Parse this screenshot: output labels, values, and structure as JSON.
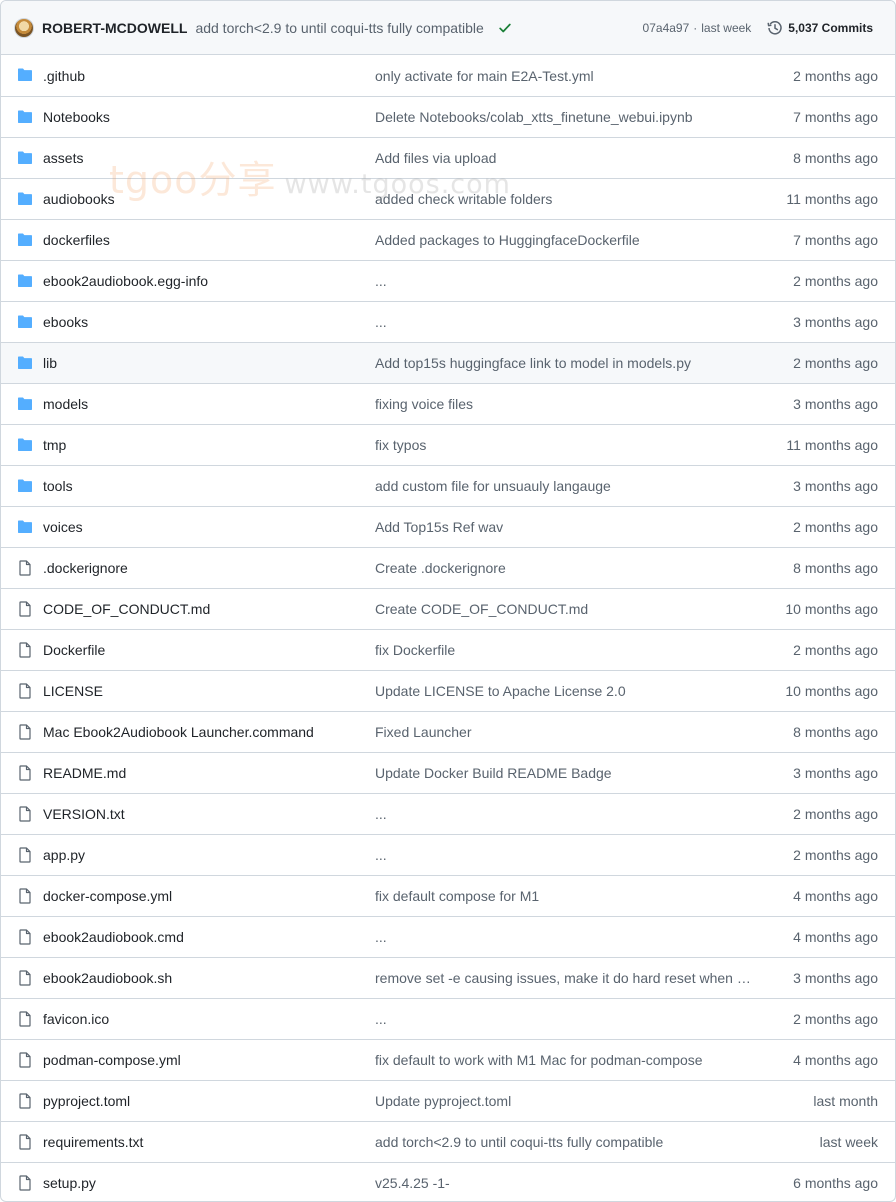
{
  "header": {
    "author": "ROBERT-MCDOWELL",
    "commit_message": "add torch<2.9 to until coqui-tts fully compatible",
    "status_icon": "check-icon",
    "hash": "07a4a97",
    "separator": "·",
    "time": "last week",
    "commits_label": "5,037 Commits"
  },
  "watermark": {
    "brand": "tgoo分享",
    "url": "www.tgoos.com"
  },
  "colors": {
    "folder": "#54aeff",
    "file": "#59636e",
    "check": "#1a7f37",
    "muted": "#59636e",
    "border": "#d0d7de"
  },
  "rows": [
    {
      "type": "folder",
      "icon": "folder-icon",
      "name": ".github",
      "message": "only activate for main E2A-Test.yml",
      "time": "2 months ago"
    },
    {
      "type": "folder",
      "icon": "folder-icon",
      "name": "Notebooks",
      "message": "Delete Notebooks/colab_xtts_finetune_webui.ipynb",
      "time": "7 months ago"
    },
    {
      "type": "folder",
      "icon": "folder-icon",
      "name": "assets",
      "message": "Add files via upload",
      "time": "8 months ago"
    },
    {
      "type": "folder",
      "icon": "folder-icon",
      "name": "audiobooks",
      "message": "added check writable folders",
      "time": "11 months ago"
    },
    {
      "type": "folder",
      "icon": "folder-icon",
      "name": "dockerfiles",
      "message": "Added packages to HuggingfaceDockerfile",
      "time": "7 months ago"
    },
    {
      "type": "folder",
      "icon": "folder-icon",
      "name": "ebook2audiobook.egg-info",
      "message": "...",
      "time": "2 months ago"
    },
    {
      "type": "folder",
      "icon": "folder-icon",
      "name": "ebooks",
      "message": "...",
      "time": "3 months ago"
    },
    {
      "type": "folder",
      "icon": "folder-icon",
      "name": "lib",
      "message": "Add top15s huggingface link to model in models.py",
      "time": "2 months ago",
      "highlighted": true
    },
    {
      "type": "folder",
      "icon": "folder-icon",
      "name": "models",
      "message": "fixing voice files",
      "time": "3 months ago"
    },
    {
      "type": "folder",
      "icon": "folder-icon",
      "name": "tmp",
      "message": "fix typos",
      "time": "11 months ago"
    },
    {
      "type": "folder",
      "icon": "folder-icon",
      "name": "tools",
      "message": "add custom file for unsuauly langauge",
      "time": "3 months ago"
    },
    {
      "type": "folder",
      "icon": "folder-icon",
      "name": "voices",
      "message": "Add Top15s Ref wav",
      "time": "2 months ago"
    },
    {
      "type": "file",
      "icon": "file-icon",
      "name": ".dockerignore",
      "message": "Create .dockerignore",
      "time": "8 months ago"
    },
    {
      "type": "file",
      "icon": "file-icon",
      "name": "CODE_OF_CONDUCT.md",
      "message": "Create CODE_OF_CONDUCT.md",
      "time": "10 months ago"
    },
    {
      "type": "file",
      "icon": "file-icon",
      "name": "Dockerfile",
      "message": "fix Dockerfile",
      "time": "2 months ago"
    },
    {
      "type": "file",
      "icon": "file-icon",
      "name": "LICENSE",
      "message": "Update LICENSE to Apache License 2.0",
      "time": "10 months ago"
    },
    {
      "type": "file",
      "icon": "file-icon",
      "name": "Mac Ebook2Audiobook Launcher.command",
      "message": "Fixed Launcher",
      "time": "8 months ago"
    },
    {
      "type": "file",
      "icon": "file-icon",
      "name": "README.md",
      "message": "Update Docker Build README Badge",
      "time": "3 months ago"
    },
    {
      "type": "file",
      "icon": "file-icon",
      "name": "VERSION.txt",
      "message": "...",
      "time": "2 months ago"
    },
    {
      "type": "file",
      "icon": "file-icon",
      "name": "app.py",
      "message": "...",
      "time": "2 months ago"
    },
    {
      "type": "file",
      "icon": "file-icon",
      "name": "docker-compose.yml",
      "message": "fix default compose for M1",
      "time": "4 months ago"
    },
    {
      "type": "file",
      "icon": "file-icon",
      "name": "ebook2audiobook.cmd",
      "message": "...",
      "time": "4 months ago"
    },
    {
      "type": "file",
      "icon": "file-icon",
      "name": "ebook2audiobook.sh",
      "message": "remove set -e causing issues, make it do hard reset when ch...",
      "time": "3 months ago"
    },
    {
      "type": "file",
      "icon": "file-icon",
      "name": "favicon.ico",
      "message": "...",
      "time": "2 months ago"
    },
    {
      "type": "file",
      "icon": "file-icon",
      "name": "podman-compose.yml",
      "message": "fix default to work with M1 Mac for podman-compose",
      "time": "4 months ago"
    },
    {
      "type": "file",
      "icon": "file-icon",
      "name": "pyproject.toml",
      "message": "Update pyproject.toml",
      "time": "last month"
    },
    {
      "type": "file",
      "icon": "file-icon",
      "name": "requirements.txt",
      "message": "add torch<2.9 to until coqui-tts fully compatible",
      "time": "last week"
    },
    {
      "type": "file",
      "icon": "file-icon",
      "name": "setup.py",
      "message": "v25.4.25 -1-",
      "time": "6 months ago"
    }
  ]
}
